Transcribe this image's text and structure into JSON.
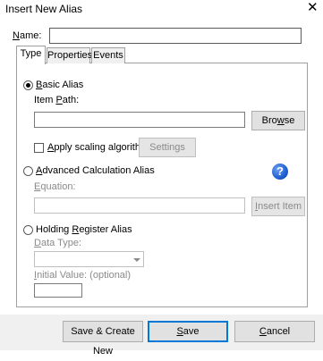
{
  "window": {
    "title": "Insert New Alias",
    "close_glyph": "✕"
  },
  "name_field": {
    "label_prefix": "",
    "label_mnemonic": "N",
    "label_rest": "ame:",
    "value": ""
  },
  "tabs": [
    {
      "label": "Type",
      "active": true
    },
    {
      "label": "Properties",
      "active": false
    },
    {
      "label": "Events",
      "active": false
    }
  ],
  "basic_alias": {
    "label_mnemonic": "B",
    "label_rest": "asic Alias",
    "item_path_prefix": "Item ",
    "item_path_mnemonic": "P",
    "item_path_rest": "ath:",
    "item_path_value": "",
    "browse_prefix": "Bro",
    "browse_mnemonic": "w",
    "browse_rest": "se",
    "apply_scaling_label_mnemonic": "A",
    "apply_scaling_label_rest": "pply scaling algorithm",
    "settings_label": "Settings"
  },
  "advanced_alias": {
    "label_mnemonic": "A",
    "label_rest": "dvanced Calculation Alias",
    "equation_mnemonic": "E",
    "equation_rest": "quation:",
    "equation_value": "",
    "insert_item_prefix": "",
    "insert_item_mnemonic": "I",
    "insert_item_rest": "nsert Item",
    "help_glyph": "?"
  },
  "holding_register_alias": {
    "label_prefix": "Holding ",
    "label_mnemonic": "R",
    "label_rest": "egister Alias",
    "data_type_prefix": "",
    "data_type_mnemonic": "D",
    "data_type_rest": "ata Type:",
    "data_type_value": "",
    "initial_value_mnemonic": "I",
    "initial_value_rest": "nitial Value: (optional)",
    "initial_value": ""
  },
  "buttons": {
    "save_create_new": "Save & Create New",
    "save_mnemonic": "S",
    "save_rest": "ave",
    "cancel_mnemonic": "C",
    "cancel_rest": "ancel"
  },
  "selected_alias_type": "basic"
}
